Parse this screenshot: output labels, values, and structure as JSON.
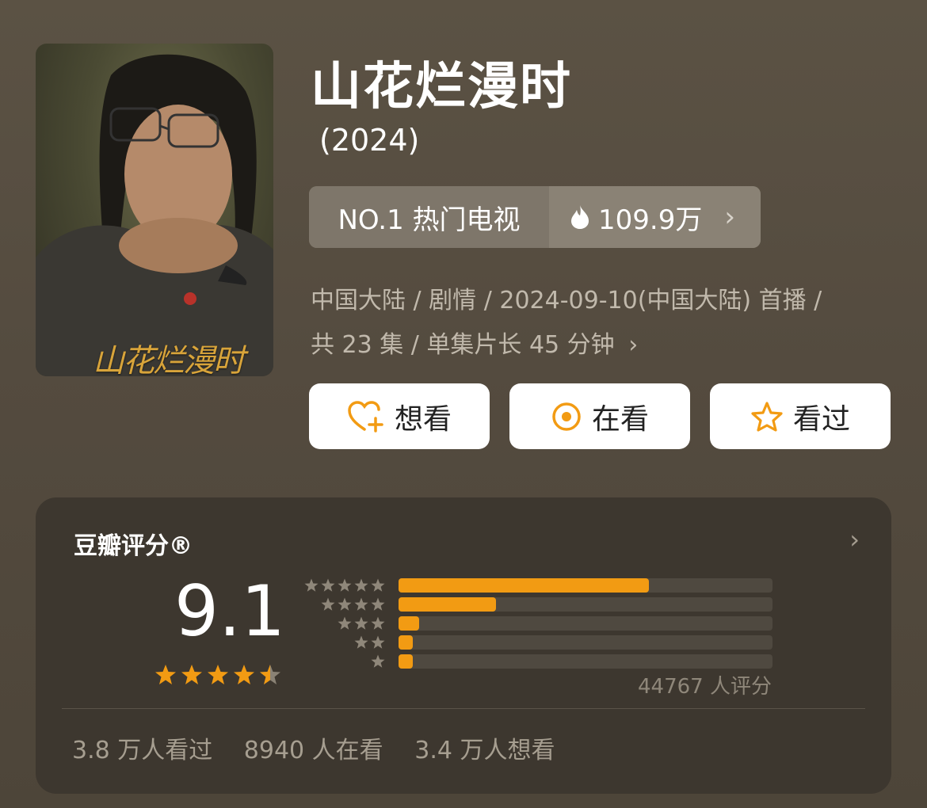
{
  "title": "山花烂漫时",
  "year": "(2024)",
  "poster": {
    "title_text": "山花烂漫时"
  },
  "rank": {
    "label": "NO.1 热门电视",
    "heat": "109.9万"
  },
  "meta": {
    "line1": "中国大陆 / 剧情 / 2024-09-10(中国大陆) 首播 /",
    "line2": "共 23 集 / 单集片长 45 分钟"
  },
  "buttons": {
    "want": "想看",
    "watching": "在看",
    "watched": "看过"
  },
  "rating": {
    "header": "豆瓣评分®",
    "score": "9.1",
    "stars": 4.5,
    "count_text": "44767 人评分",
    "distribution": [
      {
        "stars": 5,
        "fraction": 0.67
      },
      {
        "stars": 4,
        "fraction": 0.26
      },
      {
        "stars": 3,
        "fraction": 0.055
      },
      {
        "stars": 2,
        "fraction": 0.038
      },
      {
        "stars": 1,
        "fraction": 0.038
      }
    ]
  },
  "stats": {
    "watched": "3.8 万人看过",
    "watching": "8940 人在看",
    "want": "3.4 万人想看"
  },
  "colors": {
    "accent": "#f29b13",
    "background": "#544b3f",
    "card": "#3d372f"
  }
}
